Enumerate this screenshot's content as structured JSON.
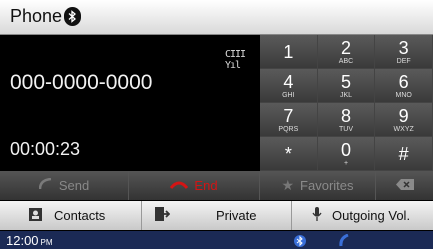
{
  "title_bar": {
    "title": "Phone",
    "icon": "bluetooth-icon"
  },
  "call": {
    "signal_text": "CIII Yıl",
    "number": "000-0000-0000",
    "duration": "00:00:23"
  },
  "keypad": [
    {
      "digit": "1",
      "letters": ""
    },
    {
      "digit": "2",
      "letters": "ABC"
    },
    {
      "digit": "3",
      "letters": "DEF"
    },
    {
      "digit": "4",
      "letters": "GHI"
    },
    {
      "digit": "5",
      "letters": "JKL"
    },
    {
      "digit": "6",
      "letters": "MNO"
    },
    {
      "digit": "7",
      "letters": "PQRS"
    },
    {
      "digit": "8",
      "letters": "TUV"
    },
    {
      "digit": "9",
      "letters": "WXYZ"
    },
    {
      "digit": "*",
      "letters": ""
    },
    {
      "digit": "0",
      "letters": "+"
    },
    {
      "digit": "#",
      "letters": ""
    }
  ],
  "actions": {
    "send": "Send",
    "end": "End",
    "favorites": "Favorites",
    "backspace_icon": "backspace-icon"
  },
  "menu": {
    "contacts": "Contacts",
    "private": "Private",
    "outgoing": "Outgoing Vol."
  },
  "status": {
    "time": "12:00",
    "ampm": "PM"
  },
  "colors": {
    "end_red": "#d41414",
    "status_bg": "#1b2a55"
  }
}
